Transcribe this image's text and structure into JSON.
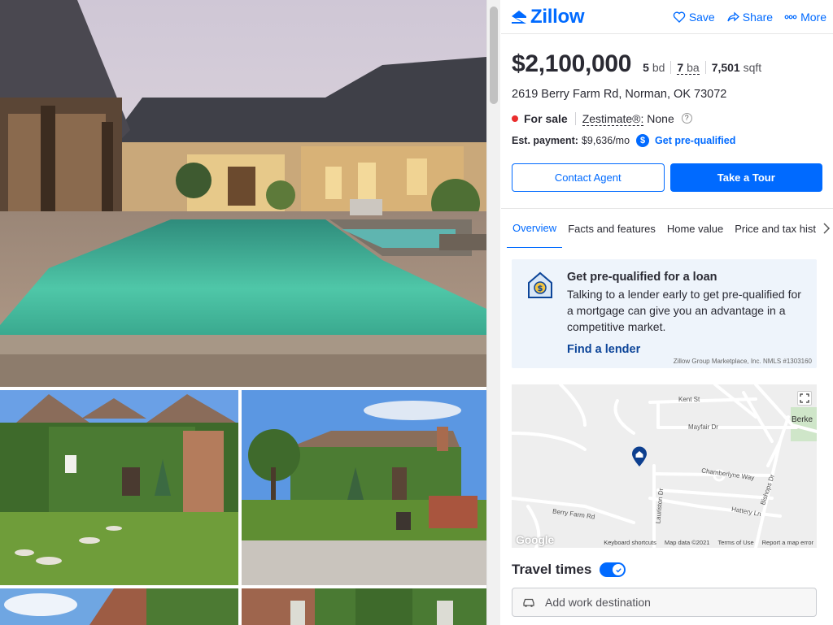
{
  "brand": {
    "name": "Zillow",
    "accent": "#006aff"
  },
  "header": {
    "save": "Save",
    "share": "Share",
    "more": "More"
  },
  "listing": {
    "price": "$2,100,000",
    "beds_n": "5",
    "beds_u": "bd",
    "baths_n": "7",
    "baths_u": "ba",
    "sqft_n": "7,501",
    "sqft_u": "sqft",
    "address": "2619 Berry Farm Rd, Norman, OK 73072",
    "status": "For sale",
    "status_color": "#ea2d2d",
    "zestimate_label": "Zestimate®:",
    "zestimate_value": "None",
    "est_payment_label": "Est. payment:",
    "est_payment_value": "$9,636/mo",
    "prequal_link": "Get pre-qualified"
  },
  "buttons": {
    "contact": "Contact Agent",
    "tour": "Take a Tour"
  },
  "tabs": [
    "Overview",
    "Facts and features",
    "Home value",
    "Price and tax hist"
  ],
  "loan": {
    "title": "Get pre-qualified for a loan",
    "body": "Talking to a lender early to get pre-qualified for a mortgage can give you an advantage in a competitive market.",
    "link": "Find a lender",
    "nmls": "Zillow Group Marketplace, Inc. NMLS #1303160"
  },
  "map": {
    "streets": {
      "kent": "Kent St",
      "mayfair": "Mayfair Dr",
      "chamberlyne": "Chamberlyne Way",
      "bishops": "Bishops Dr",
      "hattery": "Hattery Ln",
      "lauriston": "Lauriston Dr",
      "berry": "Berry Farm Rd",
      "berke": "Berke"
    },
    "google": "Google",
    "footer": {
      "shortcuts": "Keyboard shortcuts",
      "mapdata": "Map data ©2021",
      "terms": "Terms of Use",
      "report": "Report a map error"
    }
  },
  "travel": {
    "title": "Travel times",
    "enabled": true,
    "placeholder": "Add work destination"
  },
  "photos": [
    {
      "icon": "pool-backyard-photo"
    },
    {
      "icon": "ivy-house-front-photo"
    },
    {
      "icon": "ivy-house-lawn-photo"
    },
    {
      "icon": "sky-brick-photo"
    },
    {
      "icon": "ivy-brick-photo"
    }
  ]
}
